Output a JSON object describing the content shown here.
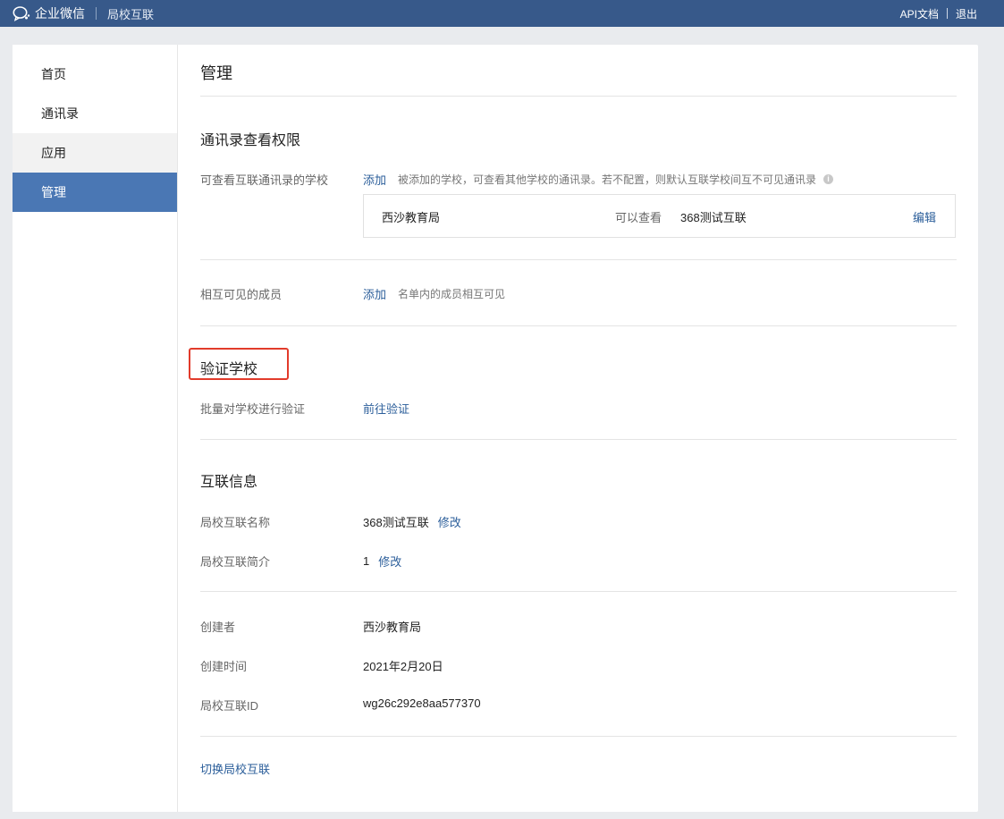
{
  "topbar": {
    "brand": "企业微信",
    "subtitle": "局校互联",
    "api_docs": "API文档",
    "logout": "退出"
  },
  "sidebar": {
    "items": [
      {
        "label": "首页"
      },
      {
        "label": "通讯录"
      },
      {
        "label": "应用"
      },
      {
        "label": "管理"
      }
    ],
    "active_index": 3
  },
  "main": {
    "title": "管理",
    "contacts_permission": {
      "title": "通讯录查看权限",
      "schools_label": "可查看互联通讯录的学校",
      "add": "添加",
      "schools_hint": "被添加的学校，可查看其他学校的通讯录。若不配置，则默认互联学校间互不可见通讯录",
      "entry": {
        "school": "西沙教育局",
        "relation": "可以查看",
        "target": "368测试互联",
        "edit": "编辑"
      },
      "members_label": "相互可见的成员",
      "members_add": "添加",
      "members_hint": "名单内的成员相互可见"
    },
    "verify": {
      "title": "验证学校",
      "batch_label": "批量对学校进行验证",
      "goto": "前往验证"
    },
    "info": {
      "title": "互联信息",
      "name_label": "局校互联名称",
      "name_value": "368测试互联",
      "name_edit": "修改",
      "intro_label": "局校互联简介",
      "intro_value": "1",
      "intro_edit": "修改",
      "creator_label": "创建者",
      "creator_value": "西沙教育局",
      "created_label": "创建时间",
      "created_value": "2021年2月20日",
      "id_label": "局校互联ID",
      "id_value": "wg26c292e8aa577370",
      "switch": "切换局校互联"
    }
  },
  "colors": {
    "topbar": "#37598a",
    "active_nav": "#4a77b4",
    "link": "#2b5e9a",
    "highlight_box": "#e23b2b"
  }
}
